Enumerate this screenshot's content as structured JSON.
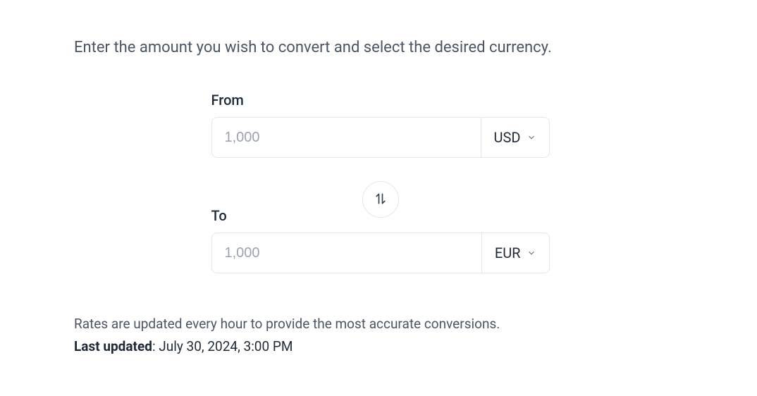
{
  "intro": "Enter the amount you wish to convert and select the desired currency.",
  "from": {
    "label": "From",
    "placeholder": "1,000",
    "currency": "USD"
  },
  "to": {
    "label": "To",
    "placeholder": "1,000",
    "currency": "EUR"
  },
  "footer": {
    "rates_info": "Rates are updated every hour to provide the most accurate conversions.",
    "last_updated_label": "Last updated",
    "last_updated_value": ": July 30, 2024, 3:00 PM"
  }
}
